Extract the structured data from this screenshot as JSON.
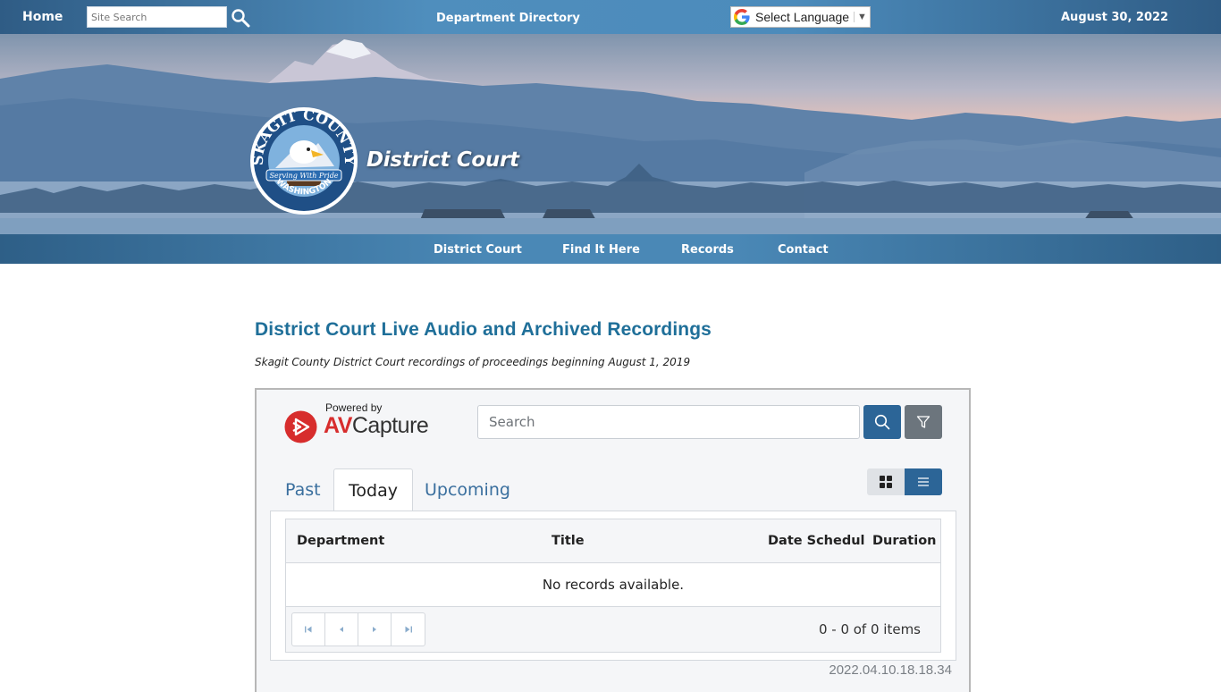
{
  "topbar": {
    "home_label": "Home",
    "search_placeholder": "Site Search",
    "search_icon": "magnifier-icon",
    "department_directory": "Department Directory",
    "language_label": "Select Language",
    "language_arrow": "▼",
    "date": "August 30, 2022"
  },
  "banner": {
    "logo_text_top": "SKAGIT COUNTY",
    "logo_banner_text": "Serving With Pride",
    "logo_text_bottom": "WASHINGTON",
    "title": "District Court"
  },
  "nav": {
    "items": [
      {
        "label": "District Court"
      },
      {
        "label": "Find It Here"
      },
      {
        "label": "Records"
      },
      {
        "label": "Contact"
      }
    ]
  },
  "main": {
    "title": "District Court Live Audio and Archived Recordings",
    "subtitle": "Skagit County District Court recordings of proceedings beginning August 1, 2019"
  },
  "avcapture": {
    "powered_by": "Powered by",
    "brand_av": "AV",
    "brand_capture": "Capture",
    "search_placeholder": "Search",
    "colors": {
      "primary": "#2c6597",
      "secondary": "#6c757d",
      "brand_red": "#d72d2d"
    },
    "tabs": [
      {
        "label": "Past",
        "active": false
      },
      {
        "label": "Today",
        "active": true
      },
      {
        "label": "Upcoming",
        "active": false
      }
    ],
    "table": {
      "columns": [
        "Department",
        "Title",
        "Date Scheduled",
        "Duration"
      ],
      "empty_message": "No records available.",
      "pager_info": "0 - 0 of 0 items"
    },
    "version": "2022.04.10.18.18.34"
  }
}
